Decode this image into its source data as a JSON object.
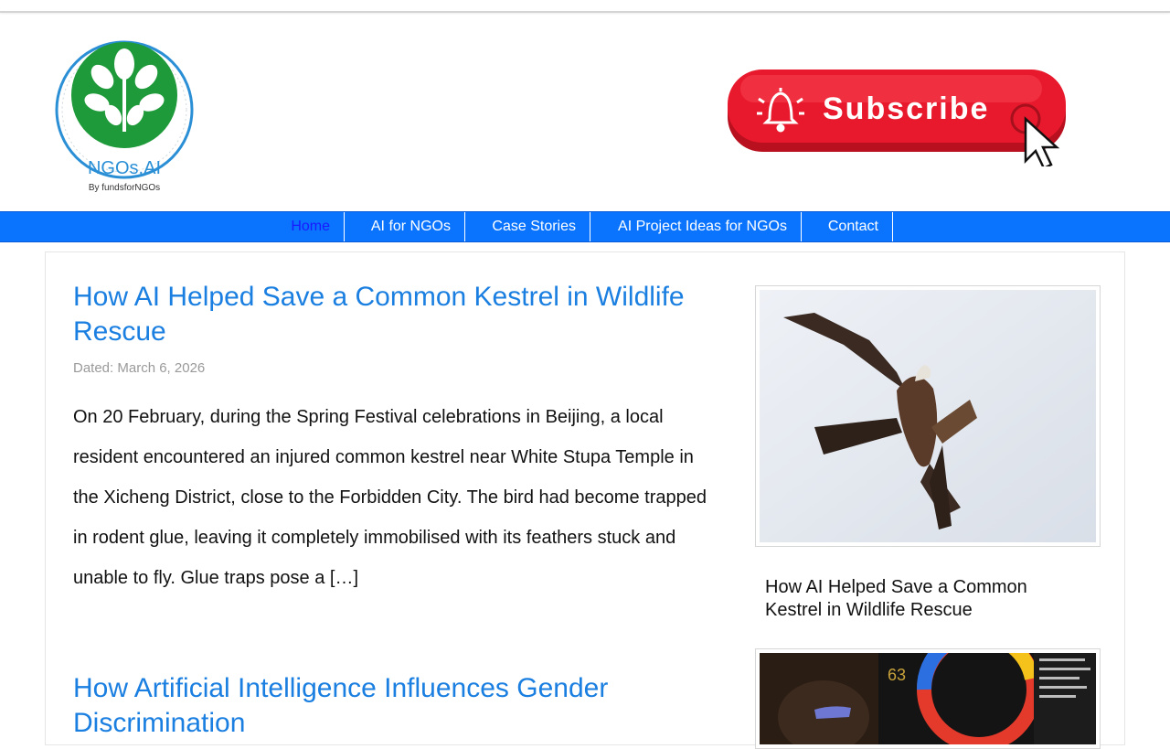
{
  "logo": {
    "text": "NGOs.AI",
    "caption": "By fundsforNGOs",
    "colors": {
      "ring": "#2b8fd6",
      "leaf": "#1e9a3a"
    }
  },
  "subscribe": {
    "label": "Subscribe",
    "icon": "bell-icon",
    "color": "#e8192c"
  },
  "nav": {
    "items": [
      {
        "label": "Home",
        "active": true
      },
      {
        "label": "AI for NGOs"
      },
      {
        "label": "Case Stories"
      },
      {
        "label": "AI Project Ideas for NGOs"
      },
      {
        "label": "Contact"
      }
    ],
    "color": "#0a74ff"
  },
  "posts": [
    {
      "title": "How AI Helped Save a Common Kestrel in Wildlife Rescue",
      "date": "Dated: March 6, 2026",
      "excerpt": "On 20 February, during the Spring Festival celebrations in Beijing, a local resident encountered an injured common kestrel near White Stupa Temple in the Xicheng District, close to the Forbidden City. The bird had become trapped in rodent glue, leaving it completely immobilised with its feathers stuck and unable to fly. Glue traps pose a […]"
    },
    {
      "title": "How Artificial Intelligence Influences Gender Discrimination"
    }
  ],
  "sidebar": {
    "cards": [
      {
        "title": "How AI Helped Save a Common Kestrel in Wildlife Rescue",
        "image": "kestrel-photo"
      },
      {
        "image": "ai-poster-photo"
      }
    ]
  }
}
